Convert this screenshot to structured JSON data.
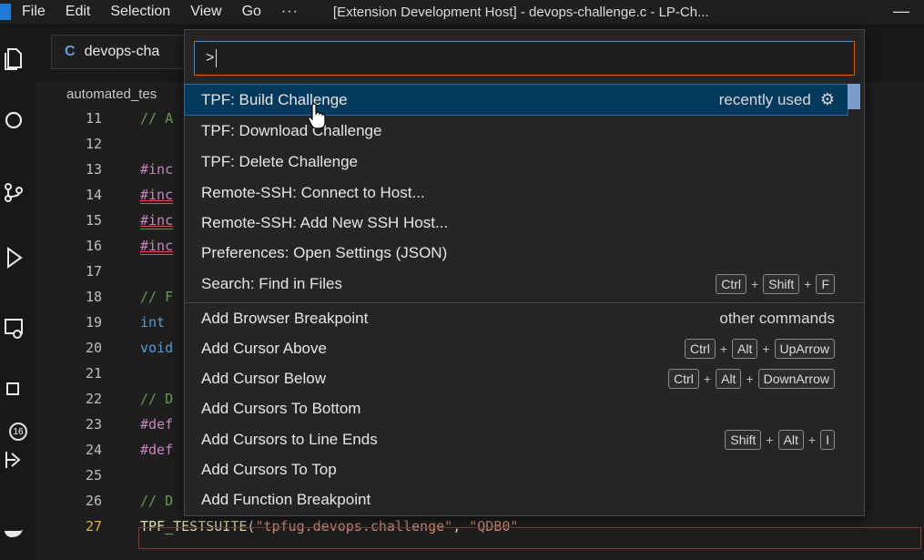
{
  "titlebar": {
    "menu": [
      "File",
      "Edit",
      "Selection",
      "View",
      "Go"
    ],
    "more": "···",
    "title": "[Extension Development Host] - devops-challenge.c - LP-Ch...",
    "minimize": "—"
  },
  "tab": {
    "label": "devops-cha",
    "lang_letter": "C"
  },
  "breadcrumb": "automated_tes",
  "code_lines": [
    {
      "n": "11",
      "text": "// A",
      "cls": "comment"
    },
    {
      "n": "12",
      "text": "",
      "cls": ""
    },
    {
      "n": "13",
      "text": "#inc",
      "cls": "dir"
    },
    {
      "n": "14",
      "text": "#inc",
      "cls": "dir squig"
    },
    {
      "n": "15",
      "text": "#inc",
      "cls": "dir squig"
    },
    {
      "n": "16",
      "text": "#inc",
      "cls": "dir squig"
    },
    {
      "n": "17",
      "text": "",
      "cls": ""
    },
    {
      "n": "18",
      "text": "// F",
      "cls": "comment"
    },
    {
      "n": "19",
      "text": "int",
      "cls": "kw"
    },
    {
      "n": "20",
      "text": "void",
      "cls": "kw"
    },
    {
      "n": "21",
      "text": "",
      "cls": ""
    },
    {
      "n": "22",
      "text": "// D",
      "cls": "comment"
    },
    {
      "n": "23",
      "text": "#def",
      "cls": "dir"
    },
    {
      "n": "24",
      "text": "#def",
      "cls": "dir"
    },
    {
      "n": "25",
      "text": "",
      "cls": ""
    },
    {
      "n": "26",
      "text": "// D",
      "cls": "comment"
    },
    {
      "n": "27",
      "text": "",
      "cls": ""
    }
  ],
  "line27": {
    "fn": "TPF_TESTSUITE",
    "open": "(",
    "str1": "\"tpfug.devops.challenge\"",
    "comma": ", ",
    "str2": "\"QDB0\""
  },
  "palette": {
    "input_value": ">",
    "items": [
      {
        "label": "TPF: Build Challenge",
        "right": "recently used",
        "gear": "⚙",
        "selected": true
      },
      {
        "label": "TPF: Download Challenge"
      },
      {
        "label": "TPF: Delete Challenge"
      },
      {
        "label": "Remote-SSH: Connect to Host..."
      },
      {
        "label": "Remote-SSH: Add New SSH Host..."
      },
      {
        "label": "Preferences: Open Settings (JSON)"
      },
      {
        "label": "Search: Find in Files",
        "keys": [
          "Ctrl",
          "Shift",
          "F"
        ]
      },
      {
        "label": "Add Browser Breakpoint",
        "right": "other commands"
      },
      {
        "label": "Add Cursor Above",
        "keys": [
          "Ctrl",
          "Alt",
          "UpArrow"
        ]
      },
      {
        "label": "Add Cursor Below",
        "keys": [
          "Ctrl",
          "Alt",
          "DownArrow"
        ]
      },
      {
        "label": "Add Cursors To Bottom"
      },
      {
        "label": "Add Cursors to Line Ends",
        "keys": [
          "Shift",
          "Alt",
          "I"
        ]
      },
      {
        "label": "Add Cursors To Top"
      },
      {
        "label": "Add Function Breakpoint"
      }
    ]
  },
  "activity_badge": "16",
  "colors": {
    "accent": "#04395e",
    "input_border": "#c06a2a"
  }
}
